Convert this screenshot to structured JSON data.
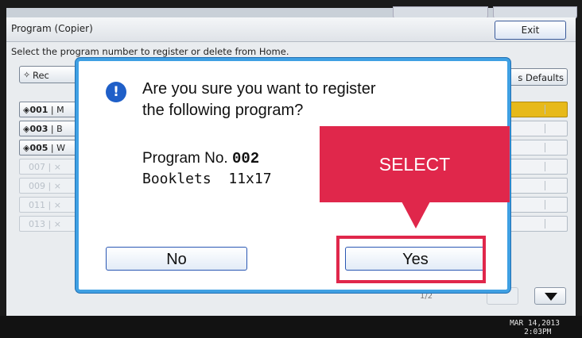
{
  "header": {
    "title": "Program (Copier)",
    "exit_label": "Exit"
  },
  "instruction": "Select the program number to register or delete from Home.",
  "recall_label": "Rec",
  "defaults_label": "s Defaults",
  "programs": [
    {
      "num": "001",
      "name": "M"
    },
    {
      "num": "003",
      "name": "B"
    },
    {
      "num": "005",
      "name": "W"
    },
    {
      "num": "007",
      "name": ""
    },
    {
      "num": "009",
      "name": ""
    },
    {
      "num": "011",
      "name": ""
    },
    {
      "num": "013",
      "name": ""
    }
  ],
  "page_indicator": "1/2",
  "datetime": {
    "date": "MAR  14,2013",
    "time": "2:03PM"
  },
  "dialog": {
    "question_line1": "Are you sure you want to register",
    "question_line2": "the following program?",
    "program_no_label": "Program No.",
    "program_no_value": "002",
    "program_name": "Booklets  11x17",
    "no_label": "No",
    "yes_label": "Yes"
  },
  "callout": {
    "text": "SELECT"
  },
  "colors": {
    "accent": "#3fa0e3",
    "callout": "#e0274b",
    "selected": "#e7b91a"
  },
  "icons": {
    "warning": "exclamation-circle-icon",
    "page_down": "triangle-down-icon"
  }
}
